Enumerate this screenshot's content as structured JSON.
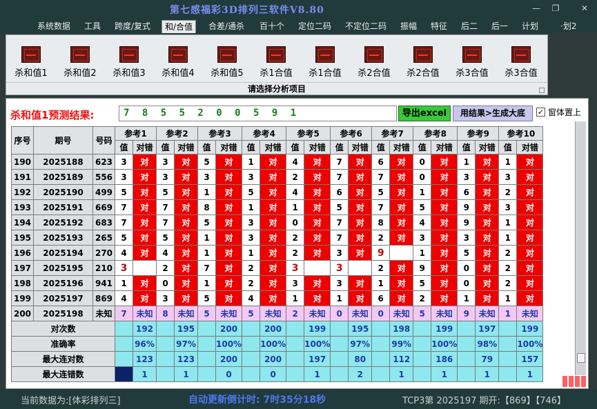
{
  "window": {
    "title": "第七感福彩3D排列三软件V8.80",
    "minimize": "—",
    "restore": "❐",
    "close": "✕"
  },
  "menu": [
    "系统数据",
    "工具",
    "跨度/复式",
    "和/合值",
    "合差/通杀",
    "百十个",
    "定位二码",
    "不定位二码",
    "振幅",
    "特征",
    "后二",
    "后一",
    "计划",
    "·划2"
  ],
  "menu_active": 3,
  "ribbon": {
    "buttons": [
      "杀和值1",
      "杀和值2",
      "杀和值3",
      "杀和值4",
      "杀和值5",
      "杀1合值",
      "杀1合值",
      "杀2合值",
      "杀2合值",
      "杀3合值",
      "杀3合值"
    ],
    "footer": "请选择分析项目"
  },
  "prediction": {
    "label": "杀和值1预测结果:",
    "value": "7 8 5 5 2 0 0 5 9 1",
    "export_button": "导出excel",
    "generate_button": "用结果>生成大底",
    "pin_checked": "✓",
    "pin_label": "窗体置上"
  },
  "table": {
    "headers": {
      "seq": "序号",
      "issue": "期号",
      "code": "号码",
      "val": "值",
      "result": "对错"
    },
    "refs": [
      "参考1",
      "参考2",
      "参考3",
      "参考4",
      "参考5",
      "参考6",
      "参考7",
      "参考8",
      "参考9",
      "参考10"
    ],
    "rows": [
      {
        "seq": "190",
        "issue": "2025188",
        "code": "623",
        "vals": [
          "3",
          "3",
          "5",
          "1",
          "4",
          "7",
          "6",
          "0",
          "1",
          "1"
        ],
        "res": [
          "对",
          "对",
          "对",
          "对",
          "对",
          "对",
          "对",
          "对",
          "对",
          "对"
        ]
      },
      {
        "seq": "191",
        "issue": "2025189",
        "code": "556",
        "vals": [
          "3",
          "3",
          "3",
          "3",
          "2",
          "7",
          "7",
          "0",
          "3",
          "3"
        ],
        "res": [
          "对",
          "对",
          "对",
          "对",
          "对",
          "对",
          "对",
          "对",
          "对",
          "对"
        ]
      },
      {
        "seq": "192",
        "issue": "2025190",
        "code": "499",
        "vals": [
          "5",
          "5",
          "1",
          "5",
          "4",
          "6",
          "5",
          "1",
          "6",
          "2"
        ],
        "res": [
          "对",
          "对",
          "对",
          "对",
          "对",
          "对",
          "对",
          "对",
          "对",
          "对"
        ]
      },
      {
        "seq": "193",
        "issue": "2025191",
        "code": "669",
        "vals": [
          "7",
          "7",
          "8",
          "1",
          "1",
          "5",
          "7",
          "5",
          "9",
          "3"
        ],
        "res": [
          "对",
          "对",
          "对",
          "对",
          "对",
          "对",
          "对",
          "对",
          "对",
          "对"
        ]
      },
      {
        "seq": "194",
        "issue": "2025192",
        "code": "683",
        "vals": [
          "7",
          "7",
          "5",
          "3",
          "0",
          "7",
          "8",
          "4",
          "9",
          "1"
        ],
        "res": [
          "对",
          "对",
          "对",
          "对",
          "对",
          "对",
          "对",
          "对",
          "对",
          "对"
        ]
      },
      {
        "seq": "195",
        "issue": "2025193",
        "code": "265",
        "vals": [
          "5",
          "5",
          "1",
          "3",
          "2",
          "7",
          "2",
          "3",
          "3",
          "1"
        ],
        "res": [
          "对",
          "对",
          "对",
          "对",
          "对",
          "对",
          "对",
          "对",
          "对",
          "对"
        ]
      },
      {
        "seq": "196",
        "issue": "2025194",
        "code": "270",
        "vals": [
          "4",
          "4",
          "1",
          "1",
          "2",
          "3",
          "9",
          "1",
          "5",
          "2"
        ],
        "res": [
          "对",
          "对",
          "对",
          "对",
          "对",
          "对",
          "",
          "对",
          "对",
          "对"
        ]
      },
      {
        "seq": "197",
        "issue": "2025195",
        "code": "210",
        "vals": [
          "3",
          "2",
          "7",
          "2",
          "3",
          "3",
          "2",
          "9",
          "0",
          "2"
        ],
        "res": [
          "",
          "对",
          "对",
          "对",
          "",
          "",
          "对",
          "对",
          "对",
          "对"
        ]
      },
      {
        "seq": "198",
        "issue": "2025196",
        "code": "941",
        "vals": [
          "1",
          "0",
          "1",
          "2",
          "3",
          "3",
          "1",
          "5",
          "0",
          "2"
        ],
        "res": [
          "对",
          "对",
          "对",
          "对",
          "对",
          "对",
          "对",
          "对",
          "对",
          "对"
        ]
      },
      {
        "seq": "199",
        "issue": "2025197",
        "code": "869",
        "vals": [
          "4",
          "3",
          "5",
          "4",
          "1",
          "1",
          "6",
          "2",
          "1",
          "1"
        ],
        "res": [
          "对",
          "对",
          "对",
          "对",
          "对",
          "对",
          "对",
          "对",
          "对",
          "对"
        ]
      },
      {
        "seq": "200",
        "issue": "2025198",
        "code": "未知",
        "vals": [
          "7",
          "8",
          "5",
          "5",
          "2",
          "0",
          "0",
          "5",
          "9",
          "1"
        ],
        "res": [
          "未知",
          "未知",
          "未知",
          "未知",
          "未知",
          "未知",
          "未知",
          "未知",
          "未知",
          "未知"
        ]
      }
    ],
    "stats": [
      {
        "label": "对次数",
        "values": [
          "192",
          "195",
          "200",
          "200",
          "199",
          "195",
          "198",
          "199",
          "197",
          "199"
        ]
      },
      {
        "label": "准确率",
        "values": [
          "96%",
          "97%",
          "100%",
          "100%",
          "100%",
          "97%",
          "99%",
          "100%",
          "98%",
          "100%"
        ]
      },
      {
        "label": "最大连对数",
        "values": [
          "123",
          "123",
          "200",
          "200",
          "197",
          "80",
          "112",
          "186",
          "79",
          "157"
        ]
      },
      {
        "label": "最大连错数",
        "values": [
          "1",
          "1",
          "0",
          "0",
          "1",
          "2",
          "1",
          "1",
          "1",
          "1"
        ]
      }
    ]
  },
  "status": {
    "data_source": "当前数据为:[体彩排列三]",
    "countdown": "自动更新倒计时: 7时35分18秒",
    "last_draw": "TCP3第 2025197 期开:【869】【746】"
  }
}
